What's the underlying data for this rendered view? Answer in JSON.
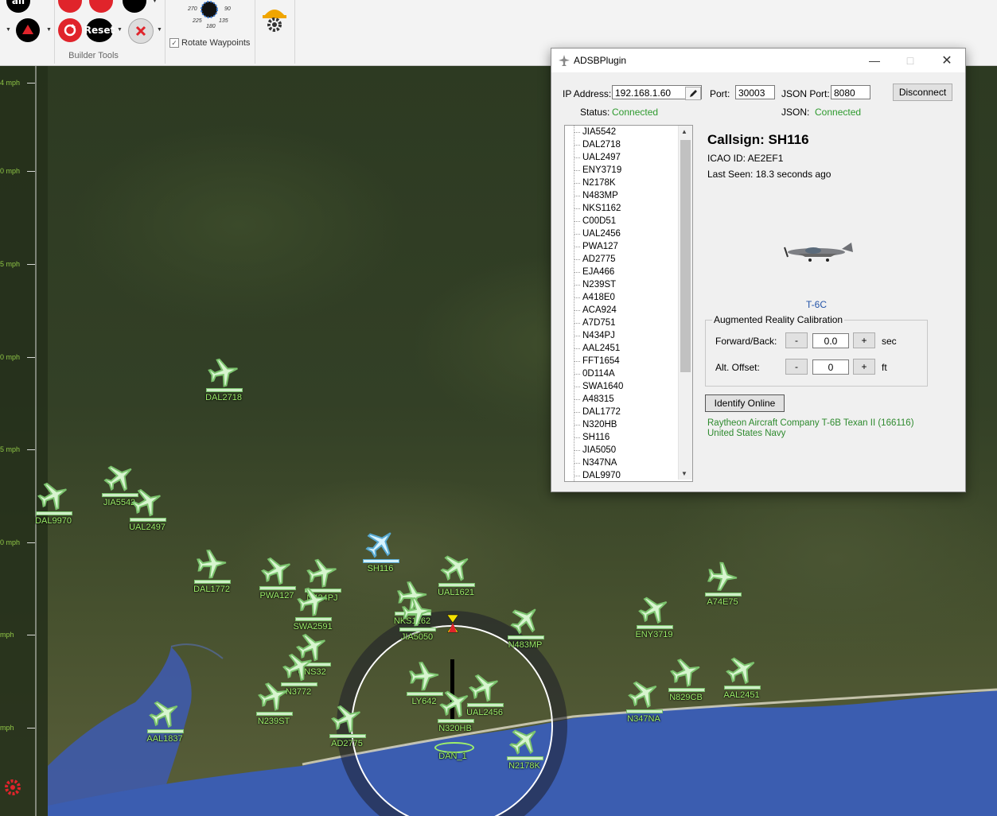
{
  "ribbon": {
    "all_button": "all",
    "reset_button": "Reset",
    "group_label": "Builder Tools",
    "compass_labels": [
      "270",
      "90",
      "225",
      "135",
      "180"
    ],
    "rotate_waypoints_label": "Rotate Waypoints",
    "rotate_waypoints_checked": true
  },
  "speed_scale": [
    "4 mph",
    "0 mph",
    "5 mph",
    "0 mph",
    "5 mph",
    "0 mph",
    "mph",
    "mph"
  ],
  "map": {
    "aircraft": [
      {
        "callsign": "DAL2718",
        "selected": false,
        "rotation": 30
      },
      {
        "callsign": "DAL9970",
        "selected": false,
        "rotation": 20
      },
      {
        "callsign": "JIA5542",
        "selected": false,
        "rotation": 10
      },
      {
        "callsign": "UAL2497",
        "selected": false,
        "rotation": 20
      },
      {
        "callsign": "SH116",
        "selected": true,
        "rotation": 0
      },
      {
        "callsign": "UAL1621",
        "selected": false,
        "rotation": 10
      },
      {
        "callsign": "DAL1772",
        "selected": false,
        "rotation": 40
      },
      {
        "callsign": "PWA127",
        "selected": false,
        "rotation": 20
      },
      {
        "callsign": "N434PJ",
        "selected": false,
        "rotation": 30
      },
      {
        "callsign": "NKS1162",
        "selected": false,
        "rotation": 40
      },
      {
        "callsign": "JIA5050",
        "selected": false,
        "rotation": 40
      },
      {
        "callsign": "N483MP",
        "selected": false,
        "rotation": 0
      },
      {
        "callsign": "ENY3719",
        "selected": false,
        "rotation": 15
      },
      {
        "callsign": "A74E75",
        "selected": false,
        "rotation": 50
      },
      {
        "callsign": "SWA2591",
        "selected": false,
        "rotation": 30
      },
      {
        "callsign": "CNS32",
        "selected": false,
        "rotation": 20
      },
      {
        "callsign": "N3772",
        "selected": false,
        "rotation": 20
      },
      {
        "callsign": "N239ST",
        "selected": false,
        "rotation": 25
      },
      {
        "callsign": "LY642",
        "selected": false,
        "rotation": 40
      },
      {
        "callsign": "UAL2456",
        "selected": false,
        "rotation": 20
      },
      {
        "callsign": "N320HB",
        "selected": false,
        "rotation": 15
      },
      {
        "callsign": "N829CB",
        "selected": false,
        "rotation": 25
      },
      {
        "callsign": "AAL2451",
        "selected": false,
        "rotation": 15
      },
      {
        "callsign": "N347NA",
        "selected": false,
        "rotation": 15
      },
      {
        "callsign": "AAL1837",
        "selected": false,
        "rotation": 15
      },
      {
        "callsign": "AD2775",
        "selected": false,
        "rotation": 20
      },
      {
        "callsign": "N2178K",
        "selected": false,
        "rotation": 5
      }
    ],
    "home_label": "DAN_1"
  },
  "plugin": {
    "title": "ADSBPlugin",
    "ip_label": "IP Address:",
    "ip_value": "192.168.1.60",
    "port_label": "Port:",
    "port_value": "30003",
    "json_port_label": "JSON Port:",
    "json_port_value": "8080",
    "disconnect_label": "Disconnect",
    "status_label": "Status:",
    "status_value": "Connected",
    "json_label": "JSON:",
    "json_value": "Connected",
    "callsigns": [
      "JIA5542",
      "DAL2718",
      "UAL2497",
      "ENY3719",
      "N2178K",
      "N483MP",
      "NKS1162",
      "C00D51",
      "UAL2456",
      "PWA127",
      "AD2775",
      "EJA466",
      "N239ST",
      "A418E0",
      "ACA924",
      "A7D751",
      "N434PJ",
      "AAL2451",
      "FFT1654",
      "0D114A",
      "SWA1640",
      "A48315",
      "DAL1772",
      "N320HB",
      "SH116",
      "JIA5050",
      "N347NA",
      "DAL9970"
    ],
    "detail": {
      "callsign_title": "Callsign: SH116",
      "icao": "ICAO ID: AE2EF1",
      "last_seen": "Last Seen: 18.3 seconds ago",
      "aircraft_type": "T-6C"
    },
    "calibration": {
      "legend": "Augmented Reality Calibration",
      "forward_label": "Forward/Back:",
      "forward_value": "0.0",
      "forward_unit": "sec",
      "alt_label": "Alt. Offset:",
      "alt_value": "0",
      "alt_unit": "ft",
      "minus": "-",
      "plus": "+"
    },
    "identify_label": "Identify Online",
    "online_info_line1": "Raytheon Aircraft Company T-6B Texan II (166116)",
    "online_info_line2": "United States Navy"
  }
}
